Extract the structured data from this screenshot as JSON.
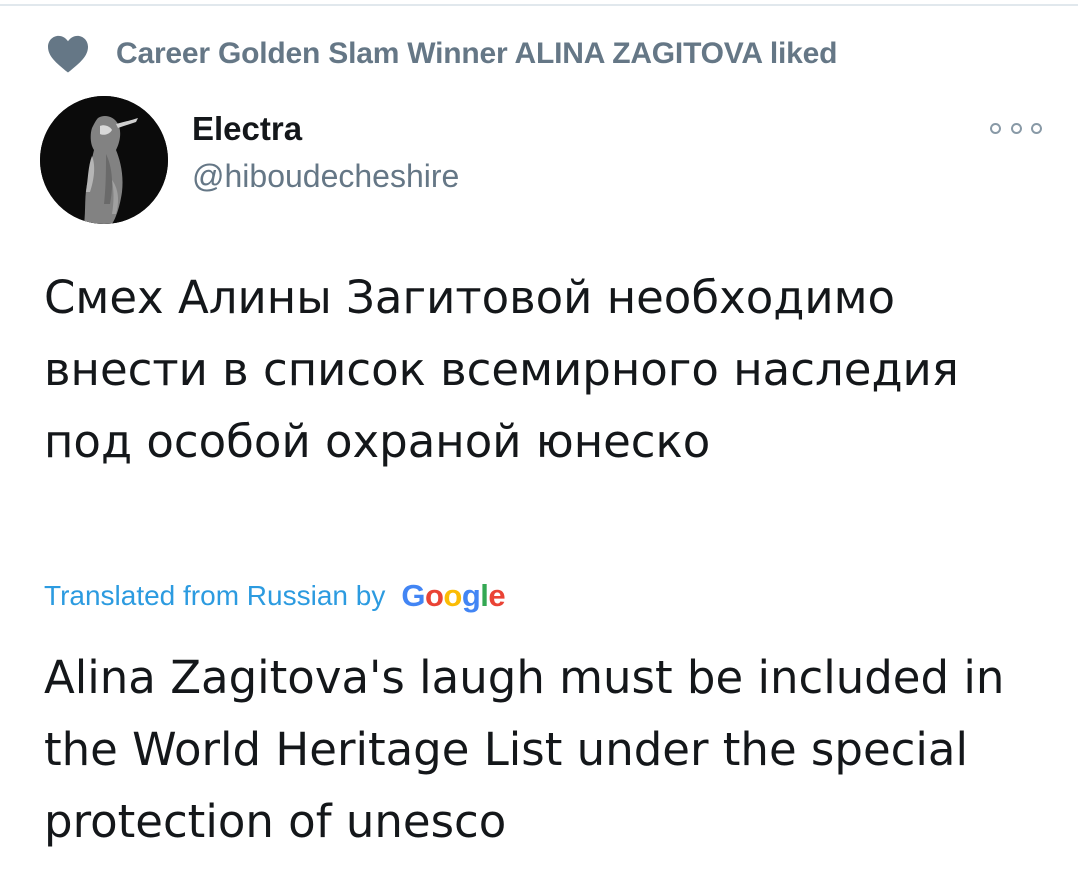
{
  "social_context": {
    "icon": "heart-icon",
    "text": "Career Golden Slam Winner ALINA ZAGITOVA liked"
  },
  "tweet": {
    "author": {
      "display_name": "Electra",
      "handle": "@hiboudecheshire"
    },
    "original_text": "Смех Алины Загитовой необходимо внести в список всемирного наследия под особой охраной юнеско",
    "translation_label": "Translated from Russian by",
    "translation_provider": "Google",
    "translated_text": "Alina Zagitova's laugh must be included in the World Heritage List under the special protection of unesco"
  },
  "colors": {
    "secondary_text": "#657786",
    "link": "#2c9be0",
    "heart": "#657786"
  }
}
